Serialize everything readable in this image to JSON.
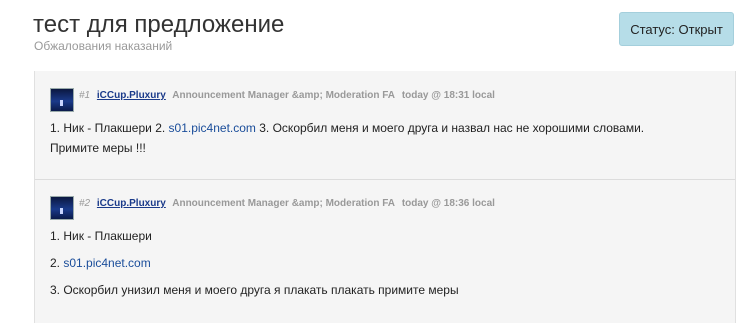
{
  "header": {
    "title": "тест для предложение",
    "subtitle": "Обжалования наказаний",
    "status_label": "Статус: Открыт"
  },
  "posts": [
    {
      "number": "#1",
      "username": "iCCup.Pluxury",
      "role": "Announcement Manager &amp; Moderation FA",
      "time": "today @ 18:31 local",
      "text_part1": "1. Ник - Плакшери 2. ",
      "link": "s01.pic4net.com",
      "text_part2": " 3. Оскорбил меня и моего друга и назвал нас не хорошими словами.",
      "text_line2": "Примите меры !!!"
    },
    {
      "number": "#2",
      "username": "iCCup.Pluxury",
      "role": "Announcement Manager &amp; Moderation FA",
      "time": "today @ 18:36 local",
      "line1": "1. Ник - Плакшери",
      "line2_prefix": "2. ",
      "line2_link": "s01.pic4net.com",
      "line3": "3. Оскорбил унизил меня и моего друга я плакать плакать примите меры"
    }
  ]
}
